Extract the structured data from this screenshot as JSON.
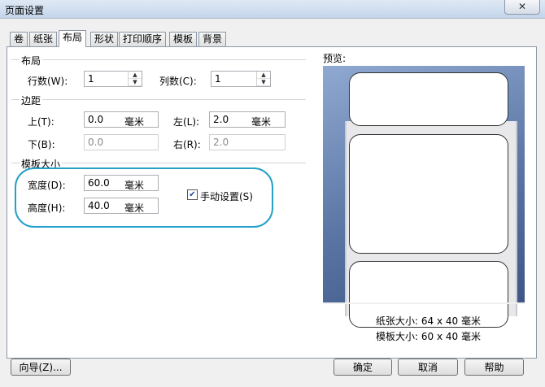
{
  "window": {
    "title": "页面设置",
    "close": "✕"
  },
  "tabs": [
    "卷",
    "纸张",
    "布局",
    "形状",
    "打印顺序",
    "模板",
    "背景"
  ],
  "layout": {
    "section": "布局",
    "rows_label": "行数(W):",
    "rows_value": "1",
    "cols_label": "列数(C):",
    "cols_value": "1"
  },
  "margins": {
    "section": "边距",
    "top_label": "上(T):",
    "top_value": "0.0",
    "top_unit": "毫米",
    "left_label": "左(L):",
    "left_value": "2.0",
    "left_unit": "毫米",
    "bottom_label": "下(B):",
    "bottom_value": "0.0",
    "right_label": "右(R):",
    "right_value": "2.0"
  },
  "template_size": {
    "section": "模板大小",
    "width_label": "宽度(D):",
    "width_value": "60.0",
    "width_unit": "毫米",
    "height_label": "高度(H):",
    "height_value": "40.0",
    "height_unit": "毫米",
    "manual_label": "手动设置(S)",
    "manual_checked": true
  },
  "preview": {
    "label": "预览:",
    "paper_size": "纸张大小: 64 x 40 毫米",
    "template_size": "模板大小: 60 x 40 毫米"
  },
  "buttons": {
    "wizard": "向导(Z)...",
    "ok": "确定",
    "cancel": "取消",
    "help": "帮助"
  },
  "colors": {
    "highlight": "#25a0c8",
    "preview_bg": "#5b76a4"
  }
}
